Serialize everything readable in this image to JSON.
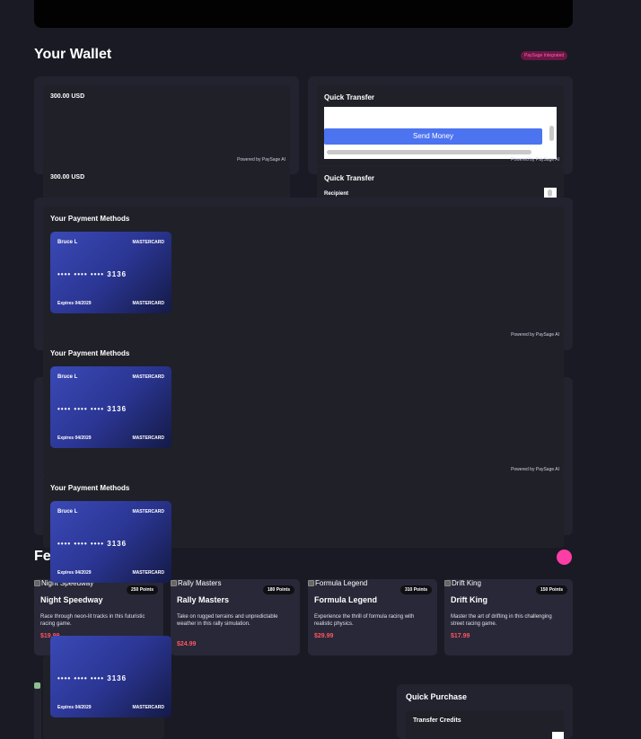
{
  "wallet": {
    "title": "Your Wallet",
    "badge": "PaySage Integrated",
    "balance": "300.00 USD",
    "powered_by": "Powered by PaySage AI"
  },
  "transfer": {
    "title": "Quick Transfer",
    "send_label": "Send Money",
    "recipient_label": "Recipient"
  },
  "payment_methods": {
    "title": "Your Payment Methods",
    "card": {
      "holder": "Bruce L",
      "brand": "MASTERCARD",
      "number": "•••• •••• •••• 3136",
      "expiry": "Expires 04/2029"
    }
  },
  "featured": {
    "title_partial": "Fe",
    "games": [
      {
        "alt": "Night Speedway",
        "title": "Night Speedway",
        "points": "250 Points",
        "desc": "Race through neon-lit tracks in this futuristic racing game.",
        "price": "$19.99"
      },
      {
        "alt": "Rally Masters",
        "title": "Rally Masters",
        "points": "180 Points",
        "desc": "Take on rugged terrains and unpredictable weather in this rally simulation.",
        "price": "$24.99"
      },
      {
        "alt": "Formula Legend",
        "title": "Formula Legend",
        "points": "310 Points",
        "desc": "Experience the thrill of formula racing with realistic physics.",
        "price": "$29.99"
      },
      {
        "alt": "Drift King",
        "title": "Drift King",
        "points": "150 Points",
        "desc": "Master the art of drifting in this challenging street racing game.",
        "price": "$17.99"
      }
    ]
  },
  "quick_purchase": {
    "title": "Quick Purchase",
    "transfer_credits": "Transfer Credits"
  },
  "colors": {
    "background": "#1a1a24",
    "panel": "#232330",
    "accent_blue": "#4c73f0",
    "accent_pink": "#ff3ea5",
    "price_red": "#ff5560"
  }
}
